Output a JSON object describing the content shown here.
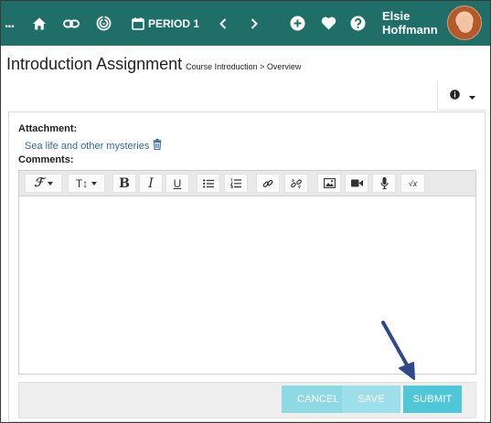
{
  "topbar": {
    "more": "...",
    "icons": [
      "home-icon",
      "link-icon",
      "target-icon",
      "calendar-icon",
      "chevron-left-icon",
      "chevron-right-icon",
      "plus-circle-icon",
      "heart-icon",
      "help-icon"
    ],
    "period_label": "PERIOD 1",
    "user_first": "Elsie",
    "user_last": "Hoffmann",
    "color": "#1f6f68"
  },
  "page": {
    "title": "Introduction Assignment",
    "breadcrumb": "Course Introduction > Overview"
  },
  "attachment": {
    "label": "Attachment:",
    "file_name": "Sea life and other mysteries"
  },
  "comments": {
    "label": "Comments:",
    "toolbar": {
      "font_label": "ℱ",
      "size_label": "T↕",
      "bold": "B",
      "italic": "I",
      "underline": "U",
      "formula": "√x"
    }
  },
  "actions": {
    "cancel": "CANCEL",
    "save": "SAVE",
    "submit": "SUBMIT",
    "accent": "#4fc7d8"
  }
}
